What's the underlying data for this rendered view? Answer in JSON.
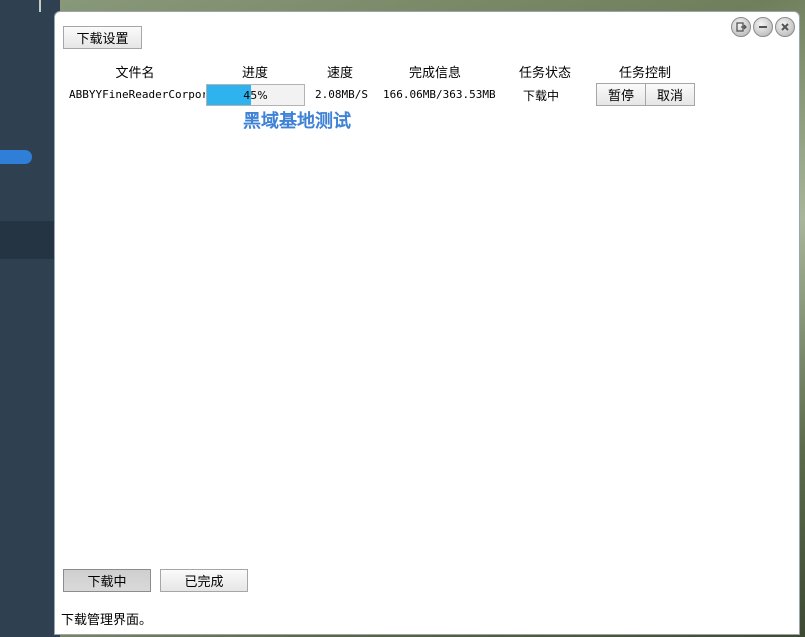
{
  "toolbar": {
    "settings_label": "下载设置"
  },
  "table": {
    "headers": {
      "filename": "文件名",
      "progress": "进度",
      "speed": "速度",
      "info": "完成信息",
      "status": "任务状态",
      "control": "任务控制"
    },
    "rows": [
      {
        "filename": "ABBYYFineReaderCorpora",
        "progress_text": "45%",
        "progress_value": 0.45,
        "speed": "2.08MB/S",
        "info": "166.06MB/363.53MB",
        "status": "下载中",
        "pause_label": "暂停",
        "cancel_label": "取消"
      }
    ]
  },
  "watermark": "黑域基地测试",
  "bottom_tabs": {
    "downloading": "下载中",
    "completed": "已完成"
  },
  "status_bar": "下载管理界面。",
  "colors": {
    "progress_fill": "#2eb3ef",
    "watermark": "#3f82d6"
  },
  "window_controls": [
    "exit-icon",
    "minimize-icon",
    "close-icon"
  ]
}
